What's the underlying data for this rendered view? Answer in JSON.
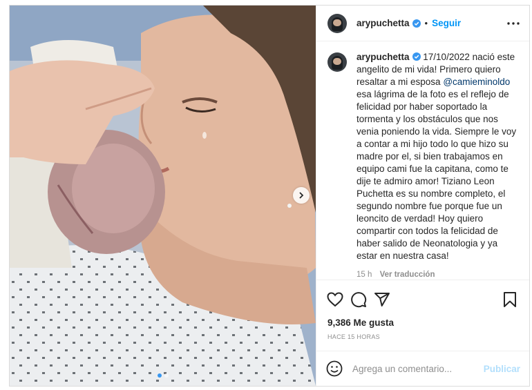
{
  "post": {
    "username": "arypuchetta",
    "follow_label": "Seguir",
    "separator": "•",
    "caption_user": "arypuchetta",
    "caption_text_1": " 17/10/2022 nació este angelito de mi vida! Primero quiero resaltar a mi esposa ",
    "mention": "@camieminoldo",
    "caption_text_2": " esa lágrima de la foto es el reflejo de felicidad por haber soportado la tormenta y los obstáculos que nos venia poniendo la vida. Siempre le voy a contar a mi hijo todo lo que hizo su madre por el, si bien trabajamos en equipo cami fue la capitana, como te dije te admiro amor! Tiziano Leon Puchetta es su nombre completo, el segundo nombre fue porque fue un leoncito de verdad! Hoy quiero compartir con todos la felicidad de haber salido de Neonatologia y ya estar en nuestra casa!",
    "caption_age": "15 h",
    "translate_label": "Ver traducción",
    "likes": "9,386 Me gusta",
    "posted_ago": "HACE 15 HORAS"
  },
  "comment": {
    "placeholder": "Agrega un comentario...",
    "publish_label": "Publicar"
  },
  "icons": {
    "verified": "verified-badge-icon",
    "more": "more-options-icon",
    "like": "heart-icon",
    "comment": "comment-bubble-icon",
    "share": "paper-plane-icon",
    "save": "bookmark-icon",
    "emoji": "emoji-icon",
    "next": "chevron-right-icon"
  },
  "carousel": {
    "slides": 2,
    "active": 1
  },
  "colors": {
    "accent": "#0095f6",
    "verified": "#3897f0",
    "publish_disabled": "#b2dffc",
    "mention": "#00376b",
    "muted": "#8e8e8e"
  }
}
